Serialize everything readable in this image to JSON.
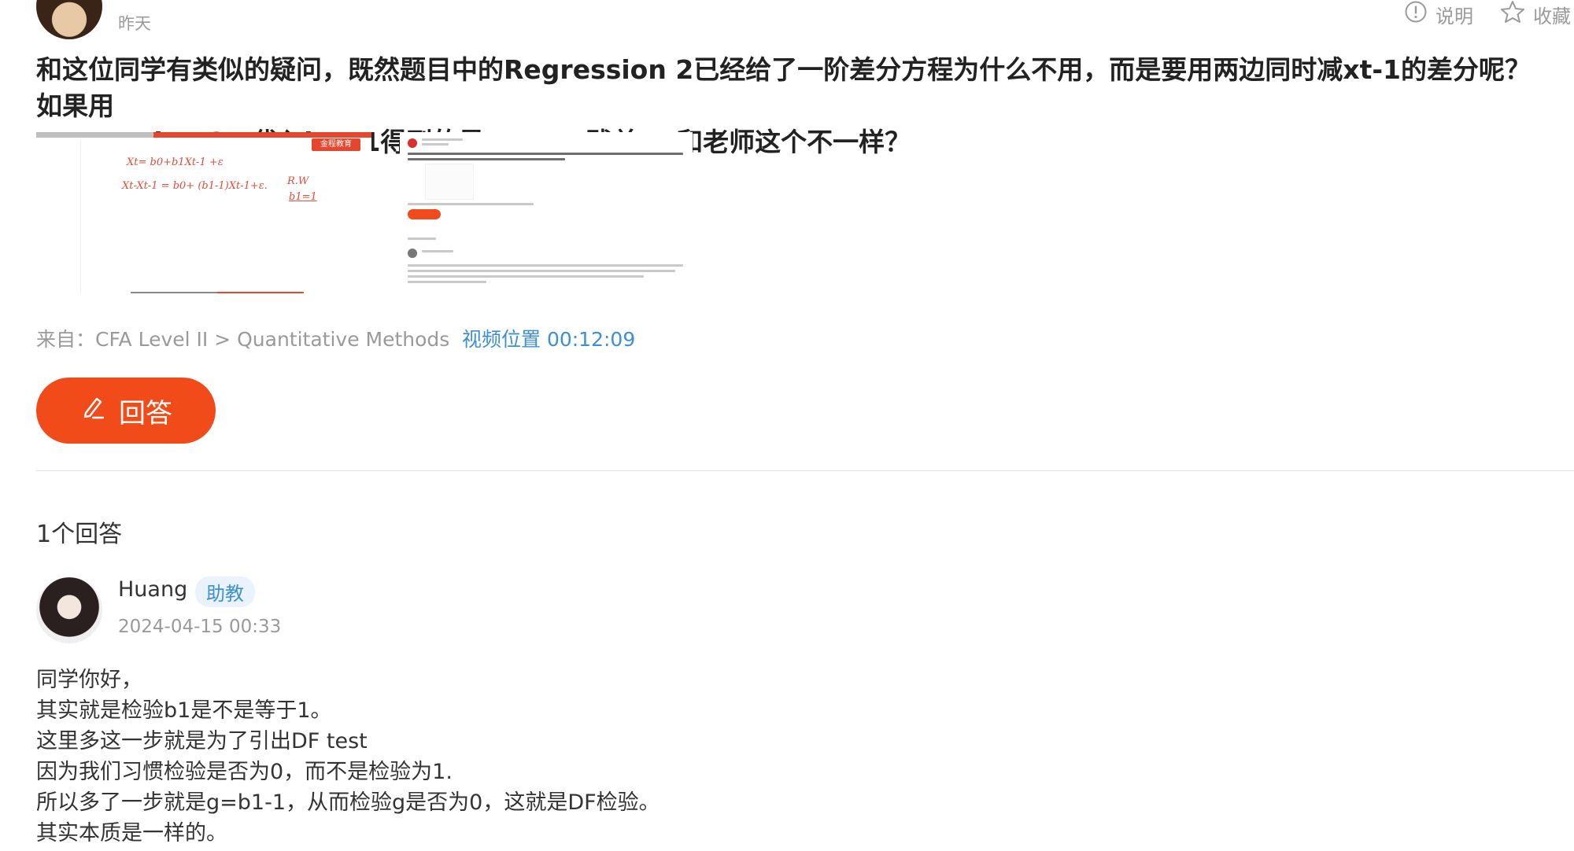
{
  "question_header": {
    "date": "昨天",
    "actions": [
      {
        "label": "说明",
        "icon": "exclamation-circle-icon"
      },
      {
        "label": "收藏",
        "icon": "star-outline-icon"
      }
    ]
  },
  "question": {
    "text_line1": "和这位同学有类似的疑问，既然题目中的Regression 2已经给了一阶差分方程为什么不用，而是要用两边同时减xt-1的差分呢？如果用",
    "text_line2": "Regression 2，代入b1=1得到的是yt=yt+残差t，和老师这个不一样？",
    "thumbnail1": {
      "logo": "金程教育",
      "eq1": "Xt= b0+b1Xt-1 +ε",
      "eq2": "Xt-Xt-1 = b0+ (b1-1)Xt-1+ε.",
      "note1": "R.W",
      "note2": "b1=1"
    }
  },
  "source": {
    "label": "来自：CFA Level II > Quantitative Methods",
    "video_position": "视频位置 00:12:09"
  },
  "answer_button": {
    "label": "回答",
    "icon": "pencil-icon"
  },
  "answers": {
    "count_label": "1个回答",
    "items": [
      {
        "name": "Huang",
        "role": "助教",
        "date": "2024-04-15 00:33",
        "lines": [
          "同学你好，",
          "其实就是检验b1是不是等于1。",
          "这里多这一步就是为了引出DF test",
          "因为我们习惯检验是否为0，而不是检验为1.",
          "所以多了一步就是g=b1-1，从而检验g是否为0，这就是DF检验。",
          "其实本质是一样的。"
        ]
      }
    ]
  },
  "colors": {
    "accent": "#f24b1a",
    "link": "#3d8fd6",
    "muted": "#9a9a9a"
  }
}
